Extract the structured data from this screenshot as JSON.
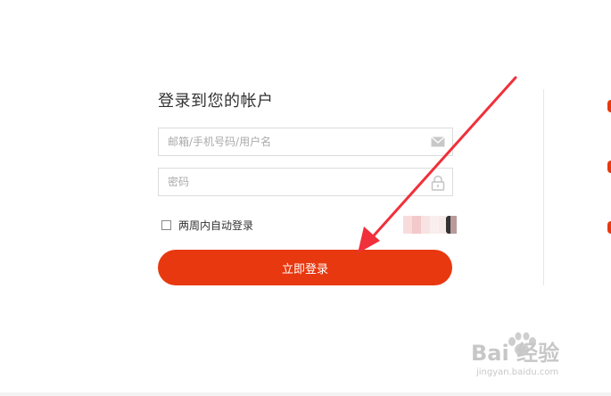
{
  "login": {
    "title": "登录到您的帐户",
    "account_placeholder": "邮箱/手机号码/用户名",
    "password_placeholder": "密码",
    "remember_label": "两周内自动登录",
    "remember_checked": false,
    "submit_label": "立即登录"
  },
  "icons": {
    "account_field": "mail-icon",
    "password_field": "lock-icon",
    "annotation": "red-arrow"
  },
  "colors": {
    "accent": "#e8380f",
    "annotation_arrow": "#f0303a"
  },
  "watermark": {
    "main": "Bai 经验",
    "sub": "jingyan.baidu.com"
  }
}
